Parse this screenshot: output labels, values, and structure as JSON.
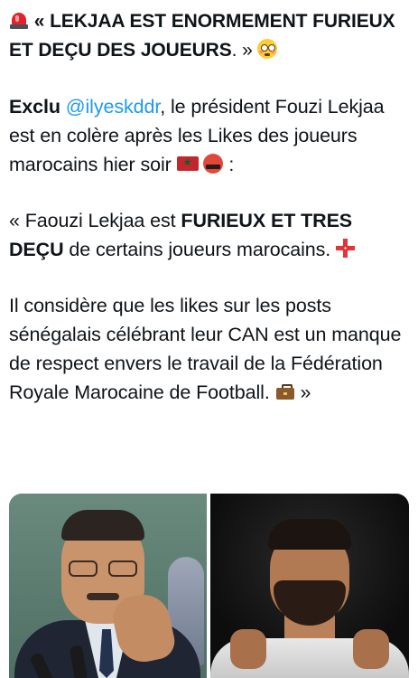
{
  "post": {
    "headline_quote_open": "« ",
    "headline_text": "LEKJAA EST ENORMEMENT FURIEUX ET DEÇU DES JOUEURS",
    "headline_tail": ". » ",
    "p1_exclu": "Exclu",
    "p1_mention": "@ilyeskddr",
    "p1_text": ", le président Fouzi Lekjaa est en colère après les Likes des joueurs marocains hier soir ",
    "p1_end": " :",
    "p2_open": "« Faouzi Lekjaa est ",
    "p2_bold": "FURIEUX ET TRES DEÇU",
    "p2_text": " de certains joueurs marocains. ",
    "p3_text": "Il considère que les likes sur les posts sénégalais célébrant leur CAN est un manque de respect envers le travail de la Fédération Royale Marocaine de Football. ",
    "p3_end": " »",
    "icons": [
      "siren-icon",
      "flushed-face-icon",
      "morocco-flag-icon",
      "angry-symbols-face-icon",
      "anger-symbol-icon",
      "briefcase-icon"
    ]
  },
  "media": {
    "count": 2,
    "items": [
      "photo-left",
      "photo-right"
    ]
  },
  "colors": {
    "text": "#0f1419",
    "mention": "#1d9bf0"
  }
}
